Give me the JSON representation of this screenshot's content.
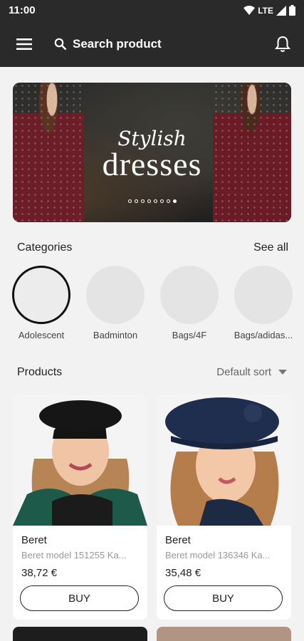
{
  "status": {
    "time": "11:00",
    "network": "LTE"
  },
  "toolbar": {
    "search_label": "Search product"
  },
  "banner": {
    "line1": "Stylish",
    "line2": "dresses",
    "page_count": 8,
    "active_page": 8
  },
  "categories": {
    "title": "Categories",
    "see_all": "See all",
    "items": [
      {
        "label": "Adolescent",
        "selected": true
      },
      {
        "label": "Badminton"
      },
      {
        "label": "Bags/4F"
      },
      {
        "label": "Bags/adidas..."
      }
    ]
  },
  "products": {
    "title": "Products",
    "sort_label": "Default sort",
    "items": [
      {
        "name": "Beret",
        "desc": "Beret model 151255 Ka...",
        "price": "38,72 €",
        "buy": "BUY"
      },
      {
        "name": "Beret",
        "desc": "Beret model 136346 Ka...",
        "price": "35,48 €",
        "buy": "BUY"
      }
    ]
  },
  "colors": {
    "app_bar": "#2a2a2a",
    "background": "#f2f2f2"
  }
}
